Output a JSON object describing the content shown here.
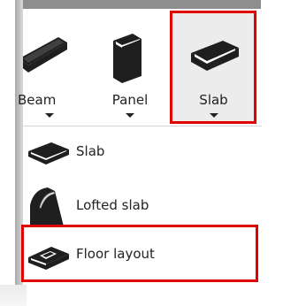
{
  "ribbon": {
    "buttons": [
      {
        "label": "Beam",
        "icon": "beam-icon",
        "has_dropdown": true
      },
      {
        "label": "Panel",
        "icon": "panel-icon",
        "has_dropdown": true
      },
      {
        "label": "Slab",
        "icon": "slab-icon",
        "has_dropdown": true,
        "highlighted": true
      }
    ]
  },
  "menu": {
    "items": [
      {
        "label": "Slab",
        "icon": "slab-icon"
      },
      {
        "label": "Lofted slab",
        "icon": "lofted-slab-icon"
      },
      {
        "label": "Floor layout",
        "icon": "floor-layout-icon",
        "highlighted": true
      }
    ]
  },
  "colors": {
    "highlight": "#e20000",
    "icon_fill": "#1f1f1f",
    "selected_bg": "#ececec"
  }
}
